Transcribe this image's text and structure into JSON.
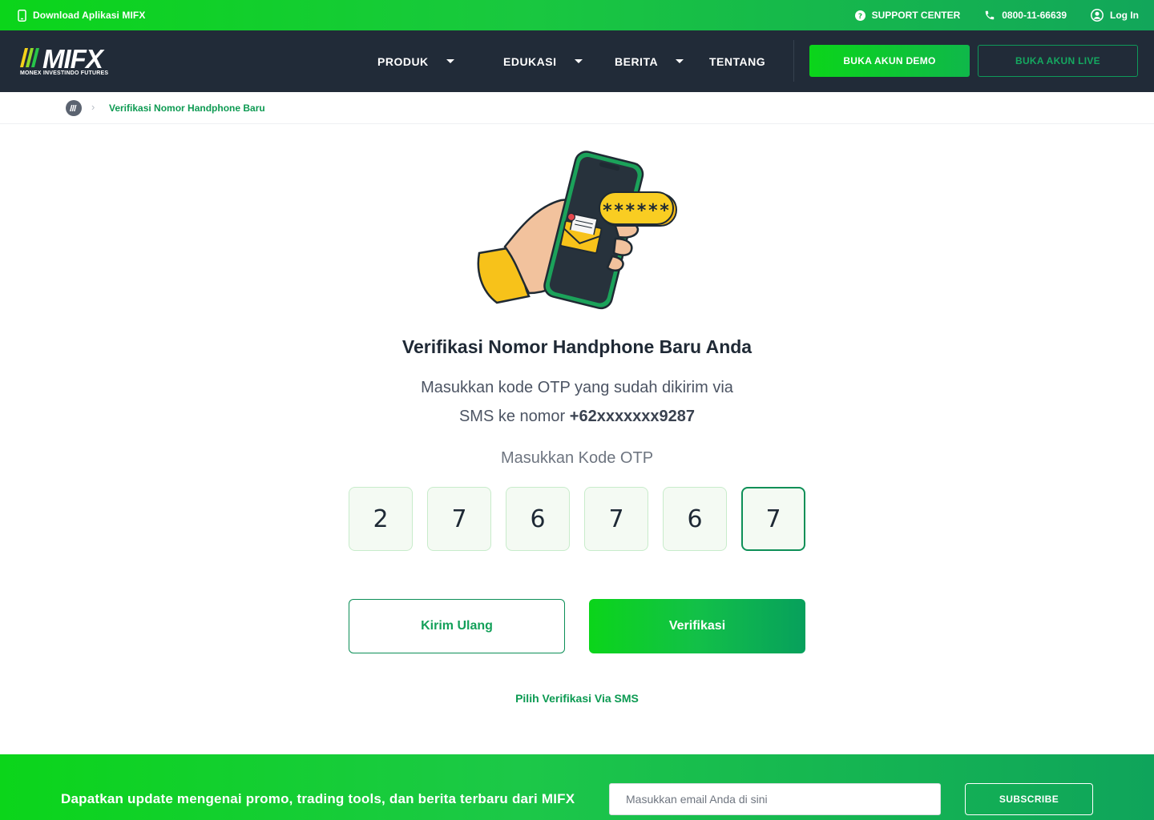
{
  "topbar": {
    "download_label": "Download Aplikasi MIFX",
    "support_label": "SUPPORT CENTER",
    "phone": "0800-11-66639",
    "login_label": "Log In"
  },
  "nav": {
    "logo_text": "MIFX",
    "logo_tagline": "MONEX INVESTINDO FUTURES",
    "menu": [
      {
        "label": "PRODUK"
      },
      {
        "label": "EDUKASI"
      },
      {
        "label": "BERITA"
      },
      {
        "label": "TENTANG"
      }
    ],
    "demo_button": "BUKA AKUN DEMO",
    "live_button": "BUKA AKUN LIVE"
  },
  "breadcrumb": {
    "current": "Verifikasi Nomor Handphone Baru"
  },
  "illustration": {
    "otp_mask": "******"
  },
  "main": {
    "title": "Verifikasi Nomor Handphone Baru Anda",
    "desc_line1": "Masukkan kode OTP yang sudah dikirim via",
    "desc_line2_prefix": "SMS ke nomor ",
    "phone_masked": "+62xxxxxxx9287",
    "otp_label": "Masukkan Kode OTP",
    "otp_digits": [
      "2",
      "7",
      "6",
      "7",
      "6",
      "7"
    ],
    "resend_button": "Kirim Ulang",
    "verify_button": "Verifikasi",
    "alt_method_link": "Pilih Verifikasi Via SMS"
  },
  "newsletter": {
    "message": "Dapatkan update mengenai promo, trading tools, dan berita terbaru dari MIFX",
    "email_placeholder": "Masukkan email Anda di sini",
    "subscribe_button": "SUBSCRIBE"
  },
  "colors": {
    "brand_green": "#0bd51a",
    "dark_green": "#0d9a52",
    "nav_bg": "#212b38"
  }
}
